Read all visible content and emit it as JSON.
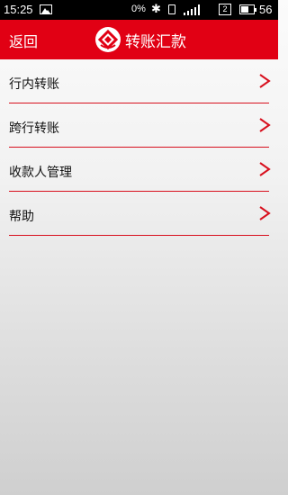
{
  "status_bar": {
    "time": "15:25",
    "network": "0%",
    "sim_label": "2",
    "battery_text": "56",
    "battery_level": 0.56
  },
  "header": {
    "back_label": "返回",
    "title": "转账汇款",
    "brand_color": "#e10014"
  },
  "menu": {
    "items": [
      {
        "label": "行内转账",
        "icon": "chevron-right-icon"
      },
      {
        "label": "跨行转账",
        "icon": "chevron-right-icon"
      },
      {
        "label": "收款人管理",
        "icon": "chevron-right-icon"
      },
      {
        "label": "帮助",
        "icon": "chevron-right-icon"
      }
    ]
  },
  "colors": {
    "accent": "#d8101e",
    "text": "#111111"
  }
}
